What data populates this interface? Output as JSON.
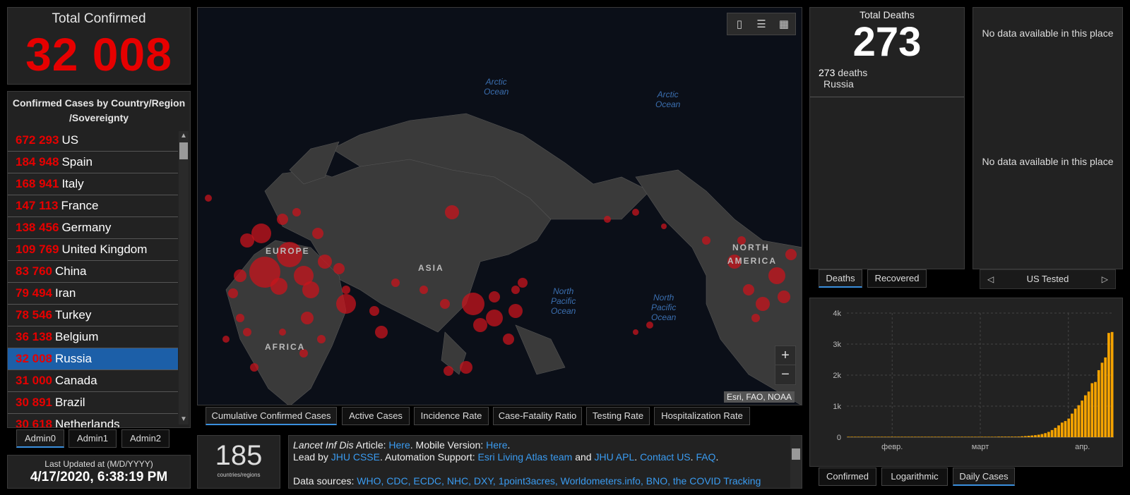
{
  "total_confirmed": {
    "label": "Total Confirmed",
    "value": "32 008"
  },
  "country_list": {
    "header": "Confirmed Cases by Country/Region /Sovereignty",
    "rows": [
      {
        "value": "672 293",
        "name": "US"
      },
      {
        "value": "184 948",
        "name": "Spain"
      },
      {
        "value": "168 941",
        "name": "Italy"
      },
      {
        "value": "147 113",
        "name": "France"
      },
      {
        "value": "138 456",
        "name": "Germany"
      },
      {
        "value": "109 769",
        "name": "United Kingdom"
      },
      {
        "value": "83 760",
        "name": "China"
      },
      {
        "value": "79 494",
        "name": "Iran"
      },
      {
        "value": "78 546",
        "name": "Turkey"
      },
      {
        "value": "36 138",
        "name": "Belgium"
      },
      {
        "value": "32 008",
        "name": "Russia",
        "selected": true
      },
      {
        "value": "31 000",
        "name": "Canada"
      },
      {
        "value": "30 891",
        "name": "Brazil"
      },
      {
        "value": "30 618",
        "name": "Netherlands"
      }
    ],
    "admin_tabs": [
      "Admin0",
      "Admin1",
      "Admin2"
    ]
  },
  "last_updated": {
    "label": "Last Updated at (M/D/YYYY)",
    "value": "4/17/2020, 6:38:19 PM"
  },
  "map": {
    "attribution": "Esri, FAO, NOAA",
    "ocean_labels": [
      "Arctic\nOcean",
      "Arctic\nOcean",
      "North\nPacific\nOcean",
      "North\nPacific\nOcean"
    ],
    "region_labels": [
      "EUROPE",
      "ASIA",
      "AFRICA",
      "NORTH",
      "AMERICA"
    ],
    "zoom_in": "+",
    "zoom_out": "−",
    "tool_icons": [
      "bookmark-icon",
      "list-icon",
      "qr-grid-icon"
    ]
  },
  "map_tabs": [
    "Cumulative Confirmed Cases",
    "Active Cases",
    "Incidence Rate",
    "Case-Fatality Ratio",
    "Testing Rate",
    "Hospitalization Rate"
  ],
  "count": {
    "value": "185",
    "label": "countries/regions"
  },
  "info": {
    "l1_a": "Lancet Inf Dis",
    "l1_b": " Article: ",
    "l1_link1": "Here",
    "l1_c": ". Mobile Version: ",
    "l1_link2": "Here",
    "l1_d": ".",
    "l2_a": "Lead by ",
    "l2_link1": "JHU CSSE",
    "l2_b": ". Automation Support: ",
    "l2_link2": "Esri Living Atlas team",
    "l2_c": " and ",
    "l2_link3": "JHU APL",
    "l2_d": ". ",
    "l2_link4": "Contact US",
    "l2_e": ". ",
    "l2_link5": "FAQ",
    "l2_f": ".",
    "l3_a": "Data sources: ",
    "l3_links": "WHO, CDC, ECDC, NHC, DXY, 1point3acres, Worldometers.info, BNO, the COVID Tracking"
  },
  "deaths": {
    "label": "Total Deaths",
    "value": "273",
    "detail_value": "273",
    "detail_unit": " deaths",
    "country": "Russia"
  },
  "deaths_tabs": [
    "Deaths",
    "Recovered"
  ],
  "tested": {
    "msg1": "No data available in this place",
    "msg2": "No data available in this place",
    "nav_label": "US Tested"
  },
  "chart_tabs": [
    "Confirmed",
    "Logarithmic",
    "Daily Cases"
  ],
  "colors": {
    "accent": "#e60000",
    "selected": "#1c5fa8",
    "bar": "#f5a300",
    "link": "#3a9bf0"
  },
  "chart_data": {
    "type": "bar",
    "x_ticks": [
      "февр.",
      "март",
      "апр."
    ],
    "y_ticks": [
      "0",
      "1k",
      "2k",
      "3k",
      "4k"
    ],
    "ylim": [
      0,
      4000
    ],
    "values": [
      0,
      0,
      0,
      0,
      0,
      0,
      0,
      0,
      0,
      0,
      0,
      0,
      0,
      0,
      0,
      0,
      0,
      0,
      0,
      0,
      0,
      0,
      0,
      0,
      0,
      0,
      0,
      0,
      0,
      0,
      0,
      0,
      0,
      0,
      0,
      0,
      0,
      0,
      0,
      0,
      0,
      0,
      0,
      0,
      0,
      2,
      3,
      5,
      8,
      10,
      15,
      20,
      28,
      35,
      45,
      55,
      65,
      80,
      100,
      130,
      170,
      230,
      300,
      380,
      470,
      520,
      600,
      760,
      920,
      1030,
      1180,
      1350,
      1470,
      1740,
      1780,
      2160,
      2400,
      2570,
      3360,
      3390
    ],
    "grid": true
  }
}
